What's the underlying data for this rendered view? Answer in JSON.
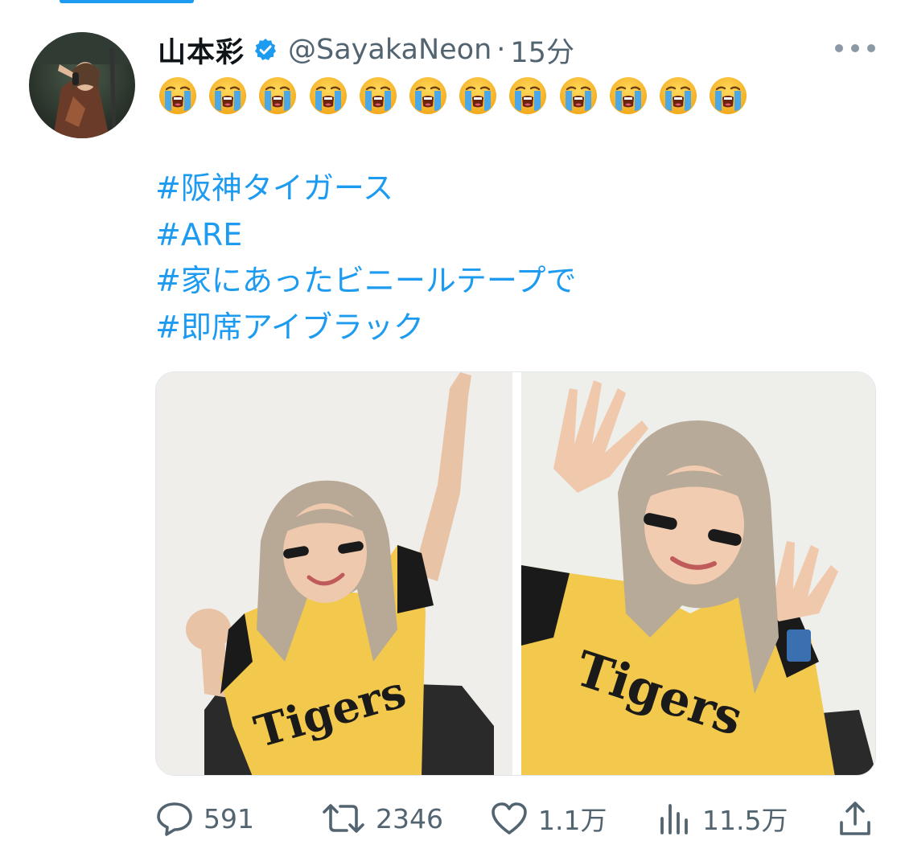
{
  "tweet": {
    "display_name": "山本彩",
    "handle": "@SayakaNeon",
    "separator": "·",
    "time": "15分",
    "emoji_count": 12,
    "emoji_name": "loudly-crying-face",
    "hashtags": [
      "#阪神タイガース",
      "#ARE",
      "#家にあったビニールテープで",
      "#即席アイブラック"
    ]
  },
  "actions": {
    "replies": "591",
    "retweets": "2346",
    "likes": "1.1万",
    "views": "11.5万"
  },
  "colors": {
    "accent": "#1d9bf0",
    "muted": "#536471",
    "jersey_yellow": "#f2c94c"
  },
  "icons": {
    "verified": "verified-badge-icon",
    "more": "more-icon",
    "reply": "reply-icon",
    "retweet": "retweet-icon",
    "like": "heart-icon",
    "views": "views-icon",
    "share": "share-icon"
  }
}
